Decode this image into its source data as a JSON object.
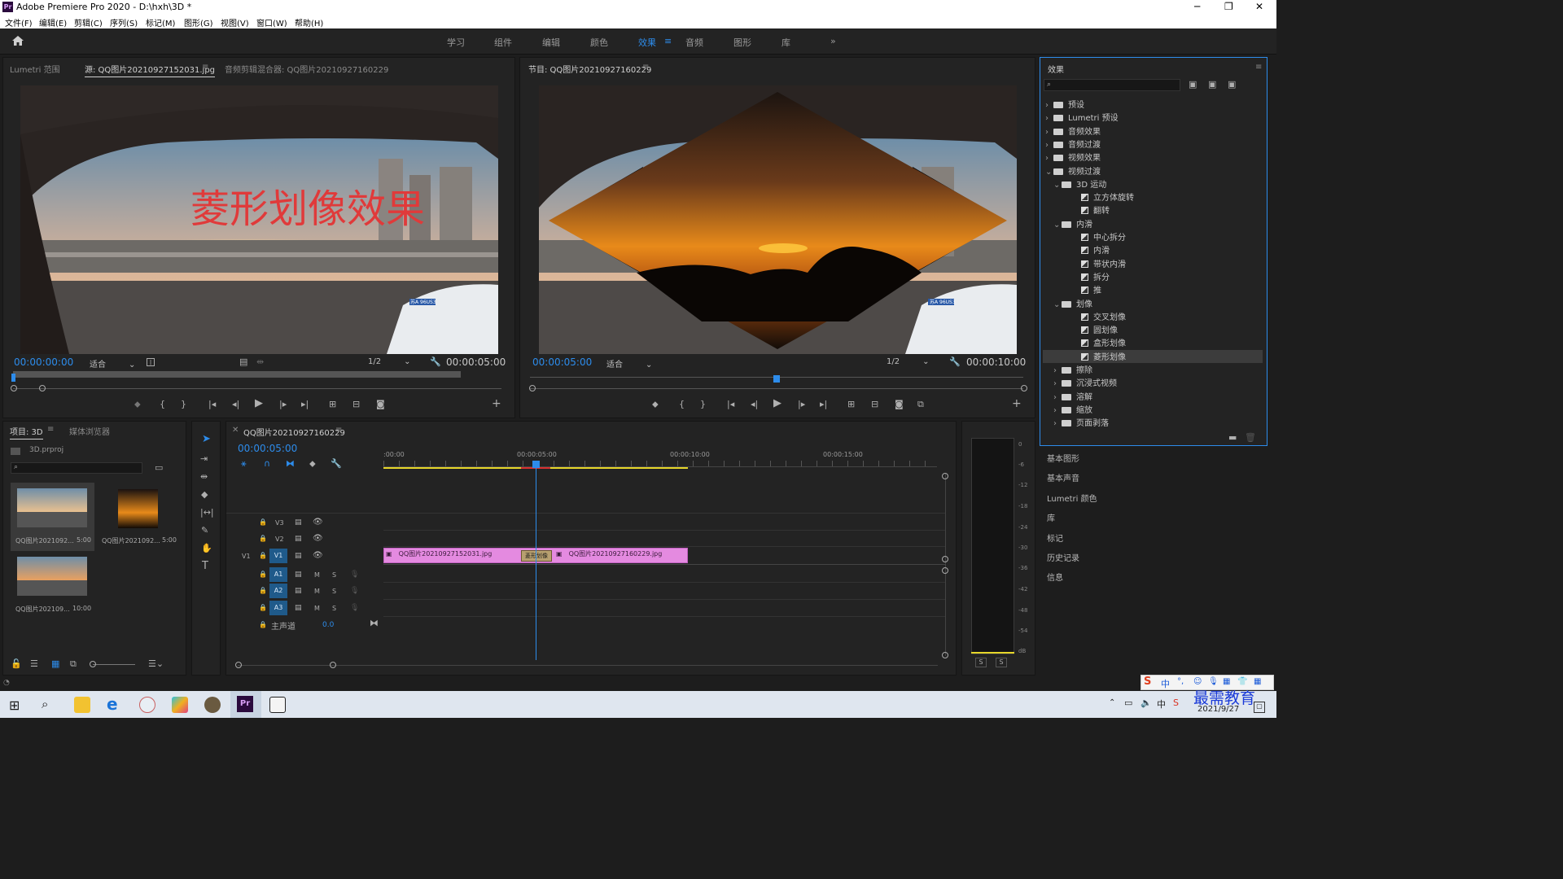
{
  "window": {
    "title": "Adobe Premiere Pro 2020 - D:\\hxh\\3D *",
    "app_badge": "Pr"
  },
  "menu": [
    "文件(F)",
    "编辑(E)",
    "剪辑(C)",
    "序列(S)",
    "标记(M)",
    "图形(G)",
    "视图(V)",
    "窗口(W)",
    "帮助(H)"
  ],
  "workspaces": [
    "学习",
    "组件",
    "编辑",
    "颜色",
    "效果",
    "音频",
    "图形",
    "库"
  ],
  "workspace_active": "效果",
  "source": {
    "tabs": [
      "Lumetri 范围",
      "源: QQ图片20210927152031.jpg",
      "音频剪辑混合器: QQ图片20210927160229"
    ],
    "overlay_text": "菱形划像效果",
    "timecode_in": "00:00:00:00",
    "fit": "适合",
    "resolution": "1/2",
    "duration": "00:00:05:00",
    "plate": "苏A 96US3"
  },
  "program": {
    "tab": "节目: QQ图片20210927160229",
    "timecode": "00:00:05:00",
    "fit": "适合",
    "resolution": "1/2",
    "duration": "00:00:10:00",
    "plate": "苏A 96US3"
  },
  "project": {
    "tabs": [
      "项目: 3D",
      "媒体浏览器"
    ],
    "file": "3D.prproj",
    "items": [
      {
        "name": "QQ图片2021092...",
        "duration": "5:00"
      },
      {
        "name": "QQ图片2021092...",
        "duration": "5:00"
      },
      {
        "name": "QQ图片202109...",
        "duration": "10:00"
      }
    ]
  },
  "timeline": {
    "tab": "QQ图片20210927160229",
    "timecode": "00:00:05:00",
    "ruler": [
      ":00:00",
      "00:00:05:00",
      "00:00:10:00",
      "00:00:15:00"
    ],
    "video_tracks": [
      "V3",
      "V2",
      "V1"
    ],
    "audio_tracks": [
      "A1",
      "A2",
      "A3"
    ],
    "track_v1_label": "V1",
    "master": "主声道",
    "master_value": "0.0",
    "clip1": "QQ图片20210927152031.jpg",
    "clip2": "QQ图片20210927160229.jpg",
    "transition": "菱形划像",
    "mute_label": "M",
    "solo_label": "S"
  },
  "meter": {
    "ticks": [
      "0",
      "-6",
      "-12",
      "-18",
      "-24",
      "-30",
      "-36",
      "-42",
      "-48",
      "-54",
      "dB"
    ],
    "solo": [
      "S",
      "S"
    ]
  },
  "effects": {
    "title": "效果",
    "tree": [
      {
        "label": "预设",
        "level": 0,
        "type": "folder",
        "open": false
      },
      {
        "label": "Lumetri 预设",
        "level": 0,
        "type": "folder",
        "open": false
      },
      {
        "label": "音频效果",
        "level": 0,
        "type": "folder",
        "open": false
      },
      {
        "label": "音频过渡",
        "level": 0,
        "type": "folder",
        "open": false
      },
      {
        "label": "视频效果",
        "level": 0,
        "type": "folder",
        "open": false
      },
      {
        "label": "视频过渡",
        "level": 0,
        "type": "folder",
        "open": true
      },
      {
        "label": "3D 运动",
        "level": 1,
        "type": "folder",
        "open": true
      },
      {
        "label": "立方体旋转",
        "level": 2,
        "type": "fx"
      },
      {
        "label": "翻转",
        "level": 2,
        "type": "fx"
      },
      {
        "label": "内滑",
        "level": 1,
        "type": "folder",
        "open": true
      },
      {
        "label": "中心拆分",
        "level": 2,
        "type": "fx"
      },
      {
        "label": "内滑",
        "level": 2,
        "type": "fx"
      },
      {
        "label": "带状内滑",
        "level": 2,
        "type": "fx"
      },
      {
        "label": "拆分",
        "level": 2,
        "type": "fx"
      },
      {
        "label": "推",
        "level": 2,
        "type": "fx"
      },
      {
        "label": "划像",
        "level": 1,
        "type": "folder",
        "open": true
      },
      {
        "label": "交叉划像",
        "level": 2,
        "type": "fx"
      },
      {
        "label": "圆划像",
        "level": 2,
        "type": "fx"
      },
      {
        "label": "盒形划像",
        "level": 2,
        "type": "fx"
      },
      {
        "label": "菱形划像",
        "level": 2,
        "type": "fx",
        "selected": true
      },
      {
        "label": "擦除",
        "level": 1,
        "type": "folder",
        "open": false
      },
      {
        "label": "沉浸式视频",
        "level": 1,
        "type": "folder",
        "open": false
      },
      {
        "label": "溶解",
        "level": 1,
        "type": "folder",
        "open": false
      },
      {
        "label": "缩放",
        "level": 1,
        "type": "folder",
        "open": false
      },
      {
        "label": "页面剥落",
        "level": 1,
        "type": "folder",
        "open": false
      }
    ]
  },
  "side_panels": [
    "基本图形",
    "基本声音",
    "Lumetri 颜色",
    "库",
    "标记",
    "历史记录",
    "信息"
  ],
  "taskbar": {
    "date": "2021/9/27",
    "ime": "中",
    "watermark": "最需教育"
  },
  "colors": {
    "accent": "#2d8ceb",
    "clip": "#e48ae0",
    "overlay_text": "#e03a3a"
  }
}
